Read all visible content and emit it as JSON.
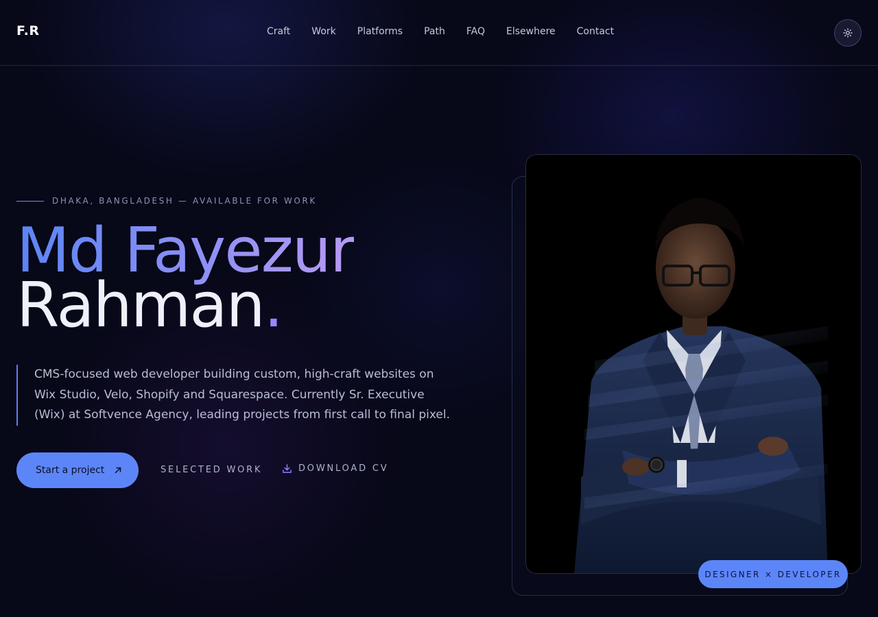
{
  "nav": {
    "logo": "F.R",
    "links": [
      "Craft",
      "Work",
      "Platforms",
      "Path",
      "FAQ",
      "Elsewhere",
      "Contact"
    ],
    "theme_toggle_icon": "sun-icon"
  },
  "hero": {
    "eyebrow": "DHAKA, BANGLADESH — AVAILABLE FOR WORK",
    "name_line1": "Md Fayezur",
    "name_line2": "Rahman",
    "name_dot": ".",
    "bio": "CMS-focused web developer building custom, high-craft websites on Wix Studio, Velo, Shopify and Squarespace. Currently Sr. Executive (Wix) at Softvence Agency, leading projects from first call to final pixel.",
    "cta_label": "Start a project",
    "cta_icon": "arrow-up-right-icon",
    "selected_work_label": "SELECTED WORK",
    "download_cv_label": "DOWNLOAD CV",
    "download_icon": "download-icon"
  },
  "portrait": {
    "badge": "DESIGNER × DEVELOPER"
  },
  "colors": {
    "background": "#070818",
    "accent": "#5c86f8",
    "accent_violet": "#9a86ff"
  }
}
